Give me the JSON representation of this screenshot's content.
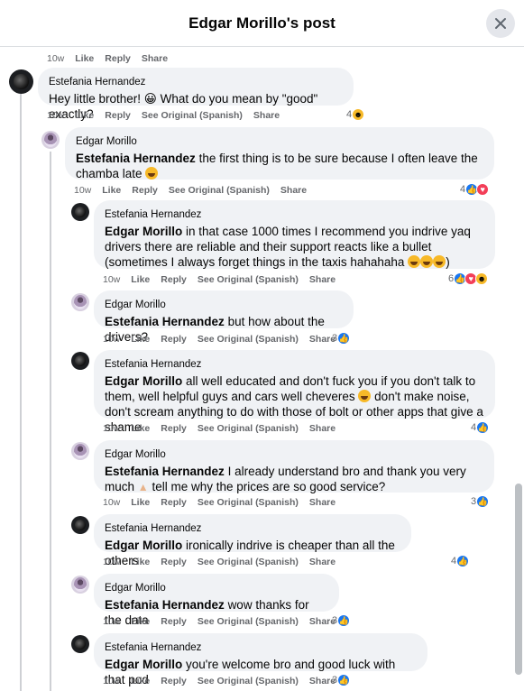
{
  "header": {
    "title": "Edgar Morillo's post"
  },
  "top_actions": {
    "time": "10w",
    "like": "Like",
    "reply": "Reply",
    "share": "Share"
  },
  "comments": [
    {
      "author": "Estefania Hernandez",
      "text": "Hey little brother! 😀 What do you mean by \"good\" exactly?",
      "time": "10w",
      "like": "Like",
      "reply": "Reply",
      "see_original": "See Original (Spanish)",
      "share": "Share",
      "reaction_count": "4"
    },
    {
      "author": "Edgar Morillo",
      "mention": "Estefania Hernandez",
      "text": "the first thing is to be sure because I often leave the chamba late",
      "time": "10w",
      "like": "Like",
      "reply": "Reply",
      "see_original": "See Original (Spanish)",
      "share": "Share",
      "reaction_count": "4"
    },
    {
      "author": "Estefania Hernandez",
      "mention": "Edgar Morillo",
      "text": "in that case 1000 times I recommend you indrive yaq drivers there are reliable and their support reacts like a bullet (sometimes I always forget things in the taxis hahahaha",
      "text_end": ")",
      "time": "10w",
      "like": "Like",
      "reply": "Reply",
      "see_original": "See Original (Spanish)",
      "share": "Share",
      "reaction_count": "6"
    },
    {
      "author": "Edgar Morillo",
      "mention": "Estefania Hernandez",
      "text": "but how about the drivers?",
      "time": "10w",
      "like": "Like",
      "reply": "Reply",
      "see_original": "See Original (Spanish)",
      "share": "Share",
      "reaction_count": "3"
    },
    {
      "author": "Estefania Hernandez",
      "mention": "Edgar Morillo",
      "text": "all well educated and don't fuck you if you don't talk to them, well helpful guys and cars well cheveres",
      "text_end": "don't make noise, don't scream anything to do with those of bolt or other apps that give a shame",
      "time": "10w",
      "like": "Like",
      "reply": "Reply",
      "see_original": "See Original (Spanish)",
      "share": "Share",
      "reaction_count": "4"
    },
    {
      "author": "Edgar Morillo",
      "mention": "Estefania Hernandez",
      "text": "I already understand bro and thank you very much",
      "text_end": "tell me why the prices are so good service?",
      "time": "10w",
      "like": "Like",
      "reply": "Reply",
      "see_original": "See Original (Spanish)",
      "share": "Share",
      "reaction_count": "3"
    },
    {
      "author": "Estefania Hernandez",
      "mention": "Edgar Morillo",
      "text": "ironically indrive is cheaper than all the others",
      "time": "10w",
      "like": "Like",
      "reply": "Reply",
      "see_original": "See Original (Spanish)",
      "share": "Share",
      "reaction_count": "4"
    },
    {
      "author": "Edgar Morillo",
      "mention": "Estefania Hernandez",
      "text": "wow thanks for the data",
      "time": "10w",
      "like": "Like",
      "reply": "Reply",
      "see_original": "See Original (Spanish)",
      "share": "Share",
      "reaction_count": "3"
    },
    {
      "author": "Estefania Hernandez",
      "mention": "Edgar Morillo",
      "text": "you're welcome bro and good luck with that pod",
      "time": "10w",
      "like": "Like",
      "reply": "Reply",
      "see_original": "See Original (Spanish)",
      "share": "Share",
      "reaction_count": "3"
    }
  ],
  "colors": {
    "like_blue": "#1877f2",
    "love_red": "#f33e58",
    "haha_yellow": "#f7b928",
    "bubble_bg": "#f0f2f5",
    "meta_gray": "#65676b"
  }
}
